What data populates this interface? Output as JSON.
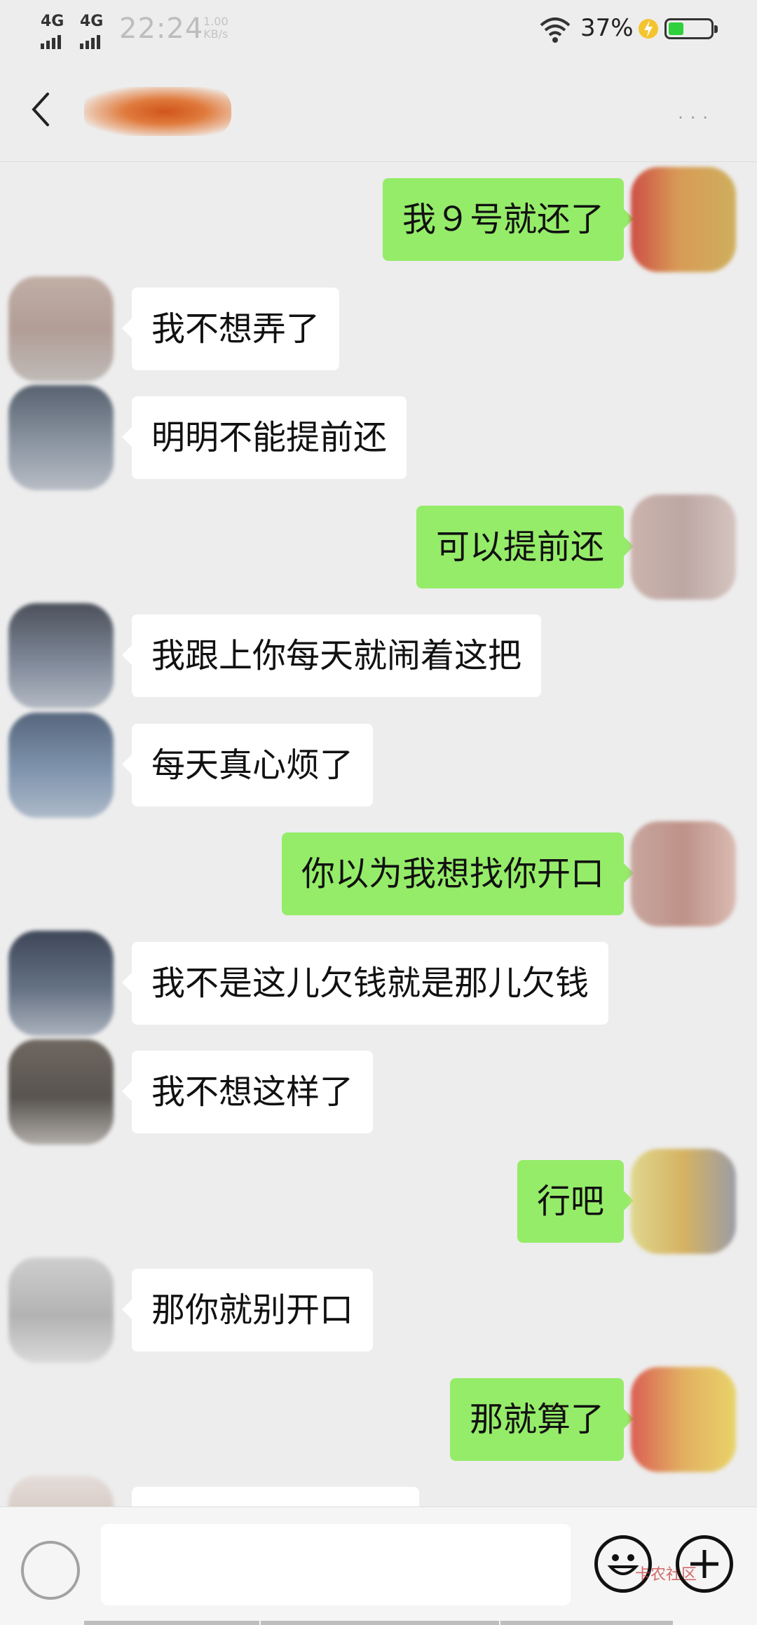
{
  "status_bar": {
    "network1": "4G",
    "network2": "4G",
    "time": "22:24",
    "speed_value": "1.00",
    "speed_unit": "KB/s",
    "battery_percent": "37%",
    "battery_level": 0.37,
    "colors": {
      "battery_fill": "#2ed03b",
      "charging_bolt": "#f4c430"
    }
  },
  "chat": {
    "colors": {
      "sent_bubble": "#95ec69",
      "received_bubble": "#ffffff",
      "background": "#ededed"
    },
    "messages": [
      {
        "side": "out",
        "text": "我９号就还了"
      },
      {
        "side": "in",
        "text": "我不想弄了"
      },
      {
        "side": "in",
        "text": "明明不能提前还"
      },
      {
        "side": "out",
        "text": "可以提前还"
      },
      {
        "side": "in",
        "text": "我跟上你每天就闹着这把"
      },
      {
        "side": "in",
        "text": "每天真心烦了"
      },
      {
        "side": "out",
        "text": "你以为我想找你开口"
      },
      {
        "side": "in",
        "text": "我不是这儿欠钱就是那儿欠钱"
      },
      {
        "side": "in",
        "text": "我不想这样了"
      },
      {
        "side": "out",
        "text": "行吧"
      },
      {
        "side": "in",
        "text": "那你就别开口"
      },
      {
        "side": "out",
        "text": "那就算了"
      },
      {
        "side": "in",
        "text": ""
      }
    ]
  },
  "input_bar": {
    "text_value": "",
    "watermark": "卡农社区"
  },
  "icons": [
    "back-arrow-icon",
    "more-icon",
    "voice-icon",
    "emoji-icon",
    "plus-icon",
    "wifi-icon",
    "charging-icon",
    "battery-icon"
  ]
}
